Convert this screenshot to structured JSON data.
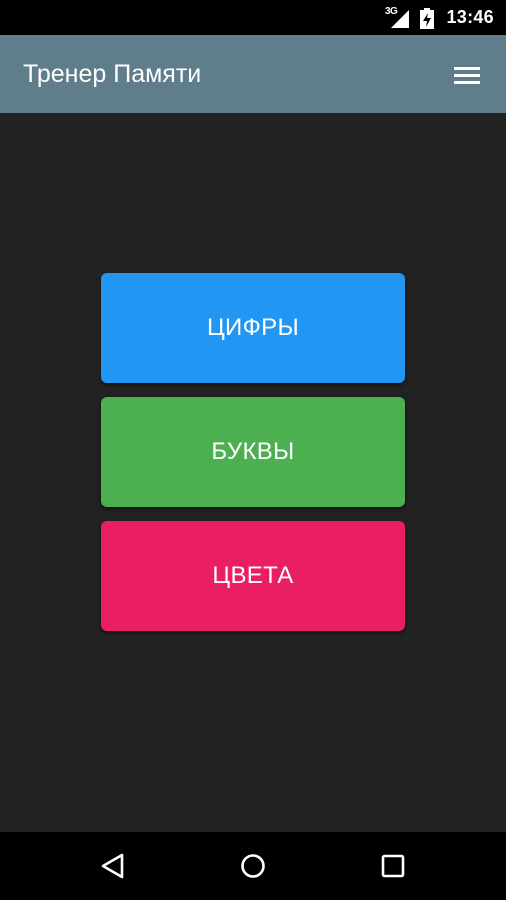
{
  "status_bar": {
    "network_type": "3G",
    "time": "13:46",
    "icons": [
      "signal-icon",
      "battery-charging-icon"
    ]
  },
  "app_bar": {
    "title": "Тренер Памяти",
    "menu_icon": "hamburger-menu-icon"
  },
  "main": {
    "buttons": [
      {
        "label": "ЦИФРЫ",
        "color": "#2196f3"
      },
      {
        "label": "БУКВЫ",
        "color": "#4caf50"
      },
      {
        "label": "ЦВЕТА",
        "color": "#e91e63"
      }
    ]
  },
  "nav_bar": {
    "icons": [
      "back-icon",
      "home-icon",
      "recents-icon"
    ]
  },
  "colors": {
    "status_bar": "#000000",
    "app_bar": "#607d8b",
    "background": "#222222",
    "nav_bar": "#000000"
  }
}
